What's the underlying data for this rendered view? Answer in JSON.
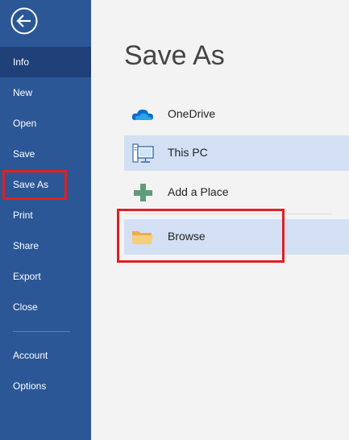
{
  "sidebar": {
    "items": [
      {
        "label": "Info"
      },
      {
        "label": "New"
      },
      {
        "label": "Open"
      },
      {
        "label": "Save"
      },
      {
        "label": "Save As"
      },
      {
        "label": "Print"
      },
      {
        "label": "Share"
      },
      {
        "label": "Export"
      },
      {
        "label": "Close"
      },
      {
        "label": "Account"
      },
      {
        "label": "Options"
      }
    ]
  },
  "main": {
    "title": "Save As",
    "locations": [
      {
        "label": "OneDrive",
        "icon": "cloud-icon"
      },
      {
        "label": "This PC",
        "icon": "computer-icon"
      },
      {
        "label": "Add a Place",
        "icon": "plus-icon"
      },
      {
        "label": "Browse",
        "icon": "folder-icon"
      }
    ]
  },
  "colors": {
    "sidebar": "#2b5797",
    "sidebar_selected": "#1e3f78",
    "selection": "#d3e0f4",
    "highlight": "#e02020"
  }
}
